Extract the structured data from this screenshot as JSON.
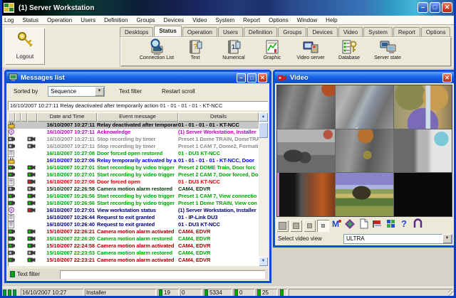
{
  "app": {
    "title": "(1) Server Workstation"
  },
  "menu": {
    "items": [
      "Log",
      "Status",
      "Operation",
      "Users",
      "Definition",
      "Groups",
      "Devices",
      "Video",
      "System",
      "Report",
      "Options",
      "Window",
      "Help"
    ]
  },
  "logout": {
    "label": "Logout"
  },
  "tabs": {
    "active_index": 1,
    "items": [
      "Desktops",
      "Status",
      "Operation",
      "Users",
      "Definition",
      "Groups",
      "Devices",
      "Video",
      "System",
      "Report",
      "Options"
    ]
  },
  "toolbar": {
    "buttons": [
      {
        "label": "Connection List",
        "icon": "connection-list-icon"
      },
      {
        "label": "Text",
        "icon": "text-status-icon"
      },
      {
        "label": "Numerical",
        "icon": "numerical-status-icon"
      },
      {
        "label": "Graphic",
        "icon": "graphic-status-icon"
      },
      {
        "label": "Video server",
        "icon": "video-server-icon"
      },
      {
        "label": "Database",
        "icon": "database-icon"
      },
      {
        "label": "Server state",
        "icon": "server-state-icon"
      }
    ]
  },
  "messages_window": {
    "title": "Messages list",
    "sorted_by_label": "Sorted by",
    "sort_value": "Sequence",
    "text_filter_label": "Text filter",
    "restart_scroll_label": "Restart scroll",
    "info_line": "16/10/2007 10:27:11  Relay deactivated after temporarily action  01 - 01 - 01 - 01 - KT-NCC",
    "columns": [
      "Date and Time",
      "Event message",
      "Details"
    ],
    "rows": [
      {
        "icon": "relay",
        "cam": null,
        "time": "16/10/2007 10:27:11",
        "event": "Relay deactivated after temporari",
        "details": "01 - 01 - 01 - 01 - KT-NCC",
        "color": "selected"
      },
      {
        "icon": "ack",
        "cam": null,
        "time": "16/10/2007 10:27:11",
        "event": "Acknowledge",
        "details": "(1)  Server Workstation, Installer",
        "color": "magenta"
      },
      {
        "icon": "camera",
        "cam": "gray",
        "time": "16/10/2007 10:27:11",
        "event": "Stop recording by timer",
        "details": "Preset 1 Dome TRAIN, DomeTRA",
        "color": "gray"
      },
      {
        "icon": "camera",
        "cam": "gray",
        "time": "16/10/2007 10:27:11",
        "event": "Stop recording by timer",
        "details": "Preset 1 CAM 7, Dome2, Formati",
        "color": "gray"
      },
      {
        "icon": "door",
        "cam": null,
        "time": "16/10/2007 10:27:08",
        "event": "Door forced open restored",
        "details": "01 - DU3 KT-NCC",
        "color": "green"
      },
      {
        "icon": "relay",
        "cam": null,
        "time": "16/10/2007 10:27:06",
        "event": "Relay temporarily activated by a",
        "details": "01 - 01 - 01 - 01 - KT-NCC, Door",
        "color": "blue"
      },
      {
        "icon": "camera",
        "cam": "green",
        "time": "16/10/2007 10:27:01",
        "event": "Start recording by video trigger",
        "details": "Preset 2 DOME Train, Door forc",
        "color": "green"
      },
      {
        "icon": "camera",
        "cam": "green",
        "time": "16/10/2007 10:27:01",
        "event": "Start recording by video trigger",
        "details": "Preset 2 CAM 7, Door forced, Do",
        "color": "green"
      },
      {
        "icon": "door",
        "cam": "red",
        "time": "16/10/2007 10:27:06",
        "event": "Door forced open",
        "details": "01 - DU3 KT-NCC",
        "color": "red"
      },
      {
        "icon": "camera",
        "cam": "gray",
        "time": "15/10/2007 22:26:58",
        "event": "Camera motion alarm restored",
        "details": "CAM4, EDVR",
        "color": "darkgreen"
      },
      {
        "icon": "camera",
        "cam": "green",
        "time": "16/10/2007 10:26:56",
        "event": "Start recording by video trigger",
        "details": "Preset 1 CAM 7, View connectio",
        "color": "green"
      },
      {
        "icon": "camera",
        "cam": "green",
        "time": "16/10/2007 10:26:56",
        "event": "Start recording by video trigger",
        "details": "Preset 1 Dome TRAIN, View con",
        "color": "green"
      },
      {
        "icon": "ack",
        "cam": "red",
        "time": "16/10/2007 10:27:01",
        "event": "View workstation status",
        "details": "(1)  Server Workstation, Installer",
        "color": "navy"
      },
      {
        "icon": "door",
        "cam": null,
        "time": "16/10/2007 10:26:44",
        "event": "Request to exit granted",
        "details": "01 - IP-Link DU3",
        "color": "navy"
      },
      {
        "icon": "door",
        "cam": null,
        "time": "16/10/2007 10:26:40",
        "event": "Request to exit granted",
        "details": "01 - DU3 KT-NCC",
        "color": "navy"
      },
      {
        "icon": "camera",
        "cam": "green",
        "time": "15/10/2007 22:26:21",
        "event": "Camera motion alarm activated",
        "details": "CAM4, EDVR",
        "color": "darkred"
      },
      {
        "icon": "camera",
        "cam": "green",
        "time": "15/10/2007 22:26:20",
        "event": "Camera motion alarm restored",
        "details": "CAM4, EDVR",
        "color": "green"
      },
      {
        "icon": "camera",
        "cam": "green",
        "time": "15/10/2007 22:24:58",
        "event": "Camera motion alarm activated",
        "details": "CAM4, EDVR",
        "color": "darkred"
      },
      {
        "icon": "camera",
        "cam": "gray",
        "time": "15/10/2007 22:23:53",
        "event": "Camera motion alarm restored",
        "details": "CAM4, EDVR",
        "color": "green"
      },
      {
        "icon": "camera",
        "cam": "green",
        "time": "15/10/2007 22:23:21",
        "event": "Camera motion alarm activated",
        "details": "CAM4, EDVR",
        "color": "darkred"
      }
    ],
    "bottom_filter_label": "Text filter",
    "bottom_filter_value": ""
  },
  "video_window": {
    "title": "Video",
    "toolbar": [
      {
        "name": "size-large-button",
        "icon": "square-large-icon",
        "pressed": false
      },
      {
        "name": "size-medium-button",
        "icon": "square-medium-icon",
        "pressed": false
      },
      {
        "name": "size-small-button",
        "icon": "square-small-icon",
        "pressed": false
      },
      {
        "name": "size-tiny-button",
        "icon": "square-tiny-icon",
        "pressed": true
      },
      {
        "name": "multiview-button",
        "icon": "m-icon"
      },
      {
        "name": "palette-button",
        "icon": "palette-icon"
      },
      {
        "name": "snapshot-button",
        "icon": "page-icon"
      },
      {
        "name": "record-flag-button",
        "icon": "flag-icon"
      },
      {
        "name": "mosaic-button",
        "icon": "mosaic-icon"
      },
      {
        "name": "help-button",
        "icon": "help-icon"
      },
      {
        "name": "exit-button",
        "icon": "exit-icon"
      }
    ],
    "select_view_label": "Select video view",
    "view_value": "ULTRA",
    "cells": [
      {
        "id": "cam-1",
        "desc": "corridor"
      },
      {
        "id": "cam-2",
        "desc": "office"
      },
      {
        "id": "cam-3",
        "desc": "dome-distorted"
      },
      {
        "id": "cam-4",
        "desc": "meeting-room"
      },
      {
        "id": "cam-5",
        "desc": "hallway"
      },
      {
        "id": "cam-6",
        "desc": "corridor-bright"
      },
      {
        "id": "cam-7",
        "desc": "hallway-red-wall"
      },
      {
        "id": "cam-8",
        "desc": "field-harvester"
      },
      {
        "id": "cam-9",
        "desc": "no-signal"
      }
    ]
  },
  "statusbar": {
    "datetime": "16/10/2007 10:27",
    "user": "Installer",
    "counters": [
      {
        "led": true,
        "value": "19"
      },
      {
        "led": false,
        "value": "0"
      },
      {
        "led": true,
        "value": "5334"
      },
      {
        "led": true,
        "value": "0"
      },
      {
        "led": true,
        "value": "25"
      },
      {
        "led": true,
        "value": ""
      }
    ]
  },
  "colors": {
    "titlebar_blue": "#0A4FD6",
    "led_green": "#0CA00C",
    "row_green": "#00A800",
    "row_red": "#F00000",
    "row_blue": "#0000F0",
    "row_magenta": "#C000C0",
    "row_gray": "#8C8C8C",
    "row_navy": "#000080",
    "row_darkred": "#B00000",
    "row_darkgreen": "#0A3A0A"
  }
}
